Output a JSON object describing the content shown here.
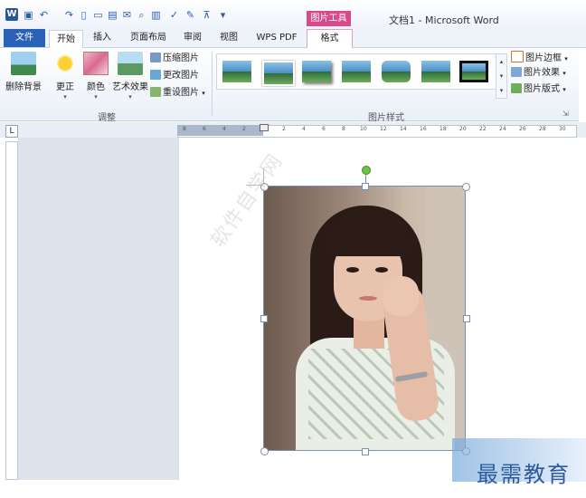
{
  "window": {
    "title": "文档1 - Microsoft Word",
    "context_tab_header": "图片工具"
  },
  "tabs": [
    {
      "label": "文件"
    },
    {
      "label": "开始"
    },
    {
      "label": "插入"
    },
    {
      "label": "页面布局"
    },
    {
      "label": "审阅"
    },
    {
      "label": "视图"
    },
    {
      "label": "WPS PDF"
    },
    {
      "label": "格式"
    }
  ],
  "ribbon": {
    "adjust": {
      "group_label": "调整",
      "remove_background": "删除背景",
      "corrections": "更正",
      "color": "颜色",
      "artistic_effects": "艺术效果",
      "compress": "压缩图片",
      "change": "更改图片",
      "reset": "重设图片"
    },
    "styles": {
      "group_label": "图片样式",
      "border": "图片边框",
      "effects": "图片效果",
      "layout": "图片版式"
    }
  },
  "ruler": {
    "ticks": [
      "8",
      "6",
      "4",
      "2",
      "2",
      "4",
      "6",
      "8",
      "10",
      "12",
      "14",
      "16",
      "18",
      "20",
      "22",
      "24",
      "26",
      "28",
      "30"
    ]
  },
  "watermark": "软件自学网",
  "corner_logo": "最需教育"
}
